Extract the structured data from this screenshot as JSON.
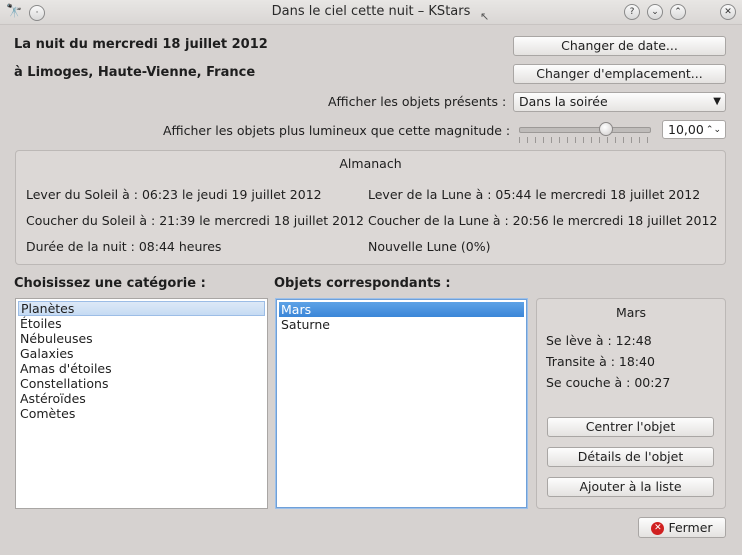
{
  "window": {
    "title": "Dans le ciel cette nuit – KStars"
  },
  "header": {
    "date_line": "La nuit du mercredi 18 juillet 2012",
    "location_line": "à Limoges, Haute-Vienne, France",
    "change_date_button": "Changer de date...",
    "change_location_button": "Changer d'emplacement..."
  },
  "filters": {
    "show_objects_label": "Afficher les objets présents :",
    "show_objects_value": "Dans la soirée",
    "magnitude_label": "Afficher les objets plus lumineux que cette magnitude :",
    "magnitude_value": "10,00",
    "magnitude_slider_fraction": 0.66
  },
  "almanac": {
    "title": "Almanach",
    "sunrise": "Lever du Soleil à : 06:23 le jeudi 19 juillet 2012",
    "sunset": "Coucher du Soleil à : 21:39 le mercredi 18 juillet 2012",
    "night_length": "Durée de la nuit : 08:44 heures",
    "moonrise": "Lever de la Lune à : 05:44 le mercredi 18 juillet 2012",
    "moonset": "Coucher de la Lune à : 20:56 le mercredi 18 juillet 2012",
    "moon_phase": "Nouvelle Lune (0%)"
  },
  "categories": {
    "label": "Choisissez une catégorie :",
    "items": [
      "Planètes",
      "Étoiles",
      "Nébuleuses",
      "Galaxies",
      "Amas d'étoiles",
      "Constellations",
      "Astéroïdes",
      "Comètes"
    ],
    "selected": "Planètes"
  },
  "objects": {
    "label": "Objets correspondants :",
    "items": [
      "Mars",
      "Saturne"
    ],
    "selected": "Mars"
  },
  "details": {
    "name": "Mars",
    "rises": "Se lève à : 12:48",
    "transits": "Transite à : 18:40",
    "sets": "Se couche à : 00:27",
    "center_button": "Centrer l'objet",
    "details_button": "Détails de l'objet",
    "add_list_button": "Ajouter à la liste"
  },
  "footer": {
    "close_button": "Fermer"
  },
  "colors": {
    "selection": "#3b86d8",
    "close_icon": "#d02020"
  }
}
